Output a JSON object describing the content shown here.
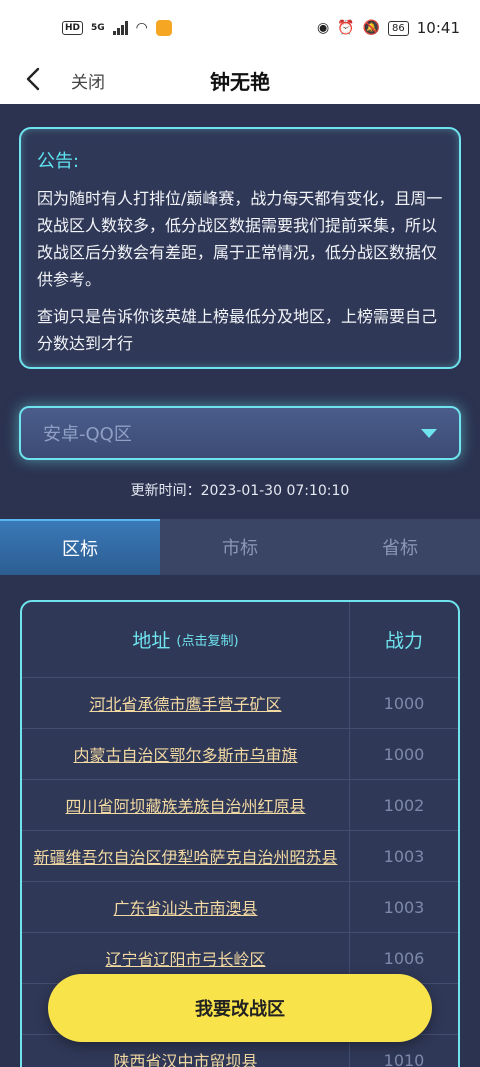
{
  "status_bar": {
    "hd_badge": "HD",
    "network": "5G",
    "battery": "86",
    "time": "10:41",
    "icons": [
      "signal-icon",
      "wifi-icon",
      "app-notification-icon",
      "eye-icon",
      "alarm-icon",
      "mute-icon",
      "battery-icon"
    ]
  },
  "app_bar": {
    "close_label": "关闭",
    "title": "钟无艳"
  },
  "notice": {
    "title": "公告:",
    "paragraph1": "因为随时有人打排位/巅峰赛，战力每天都有变化，且周一改战区人数较多，低分战区数据需要我们提前采集，所以改战区后分数会有差距，属于正常情况，低分战区数据仅供参考。",
    "paragraph2": "查询只是告诉你该英雄上榜最低分及地区，上榜需要自己分数达到才行"
  },
  "region_select": {
    "value": "安卓-QQ区"
  },
  "update_time": "更新时间：2023-01-30 07:10:10",
  "tabs": [
    {
      "label": "区标",
      "active": true
    },
    {
      "label": "市标",
      "active": false
    },
    {
      "label": "省标",
      "active": false
    }
  ],
  "table": {
    "address_header": "地址",
    "address_hint": "(点击复制)",
    "power_header": "战力",
    "rows": [
      {
        "address": "河北省承德市鹰手营子矿区",
        "power": "1000"
      },
      {
        "address": "内蒙古自治区鄂尔多斯市乌审旗",
        "power": "1000"
      },
      {
        "address": "四川省阿坝藏族羌族自治州红原县",
        "power": "1002"
      },
      {
        "address": "新疆维吾尔自治区伊犁哈萨克自治州昭苏县",
        "power": "1003"
      },
      {
        "address": "广东省汕头市南澳县",
        "power": "1003"
      },
      {
        "address": "辽宁省辽阳市弓长岭区",
        "power": "1006"
      },
      {
        "address": "",
        "power": ""
      },
      {
        "address": "陕西省汉中市留坝县",
        "power": "1010"
      }
    ]
  },
  "cta_label": "我要改战区",
  "colors": {
    "background": "#2b3350",
    "accent": "#6fe3ee",
    "address_text": "#f3d9a2",
    "cta": "#f9e34b",
    "tab_active": "#3a79b8"
  }
}
